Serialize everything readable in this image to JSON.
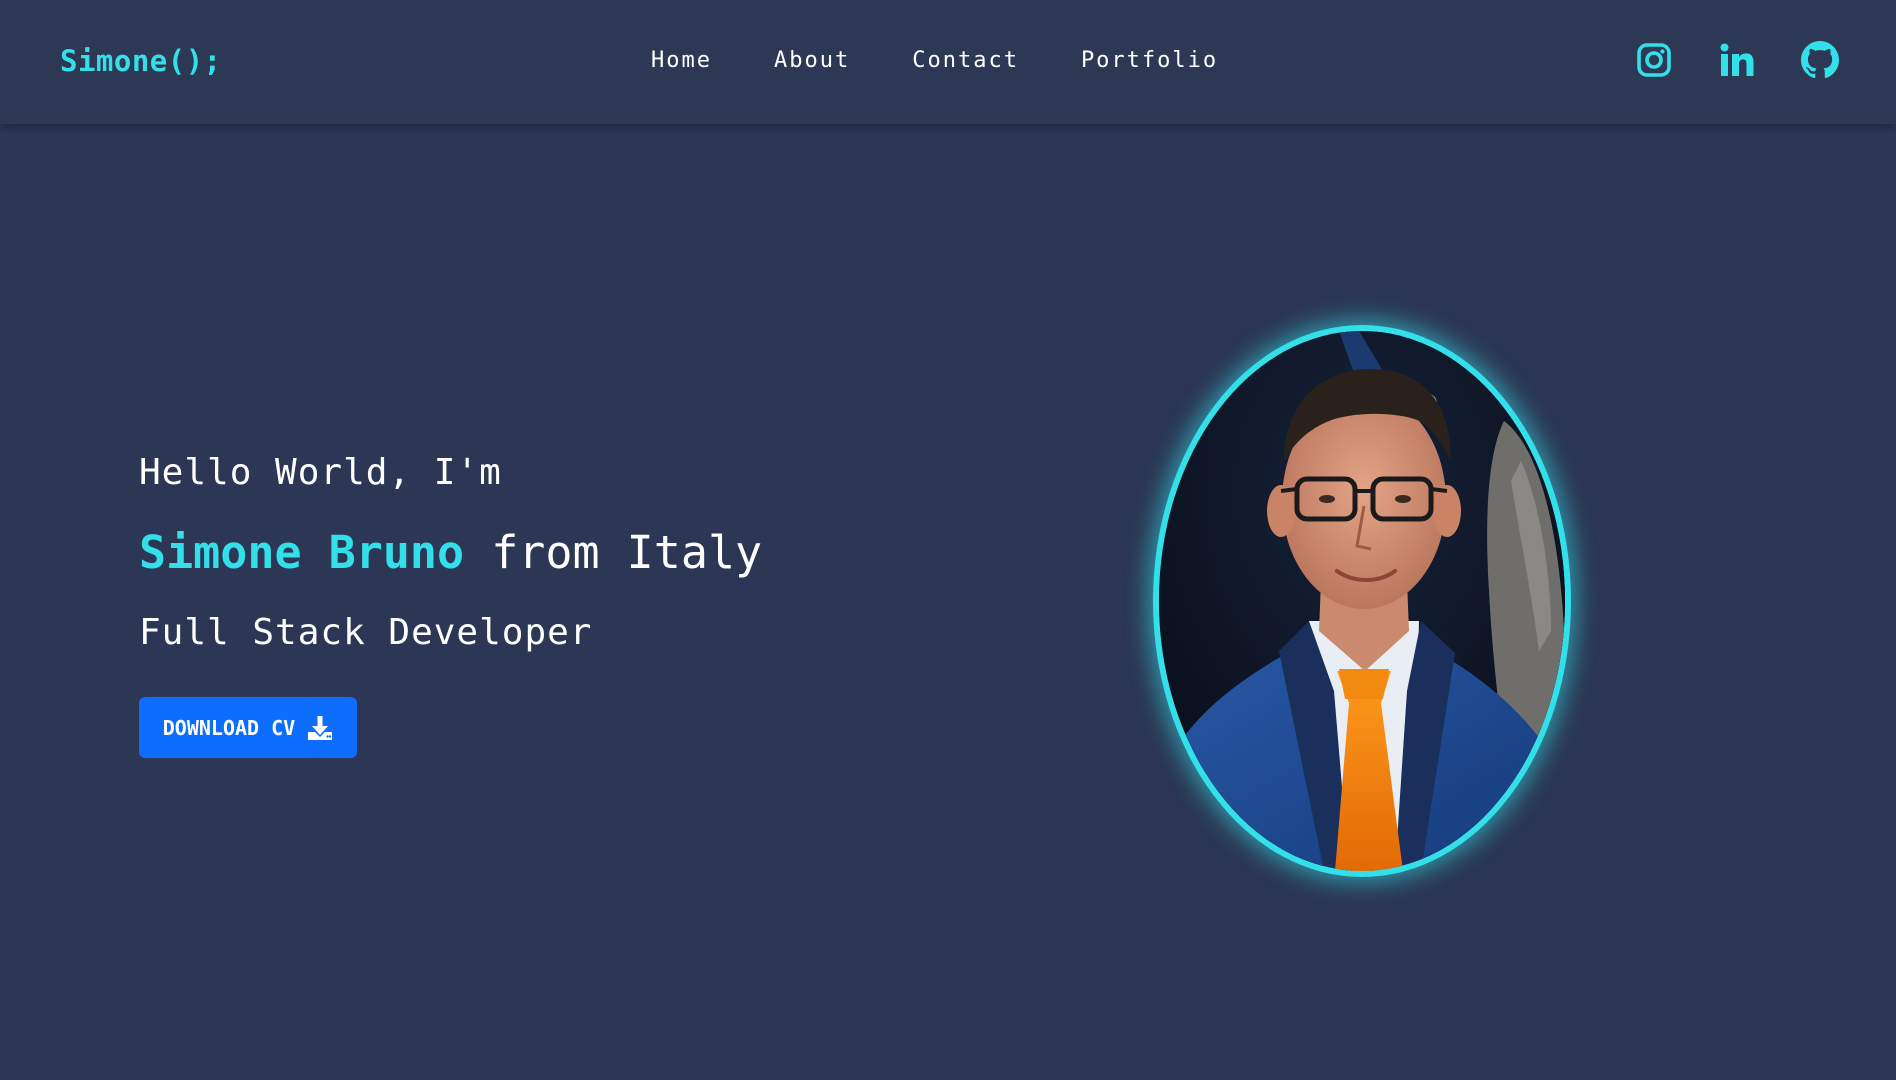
{
  "header": {
    "logo": "Simone();",
    "nav": [
      {
        "label": "Home"
      },
      {
        "label": "About"
      },
      {
        "label": "Contact"
      },
      {
        "label": "Portfolio"
      }
    ],
    "socials": [
      {
        "icon": "instagram-icon"
      },
      {
        "icon": "linkedin-icon"
      },
      {
        "icon": "github-icon"
      }
    ]
  },
  "hero": {
    "greeting": "Hello World, I'm",
    "name": "Simone Bruno",
    "origin": " from Italy",
    "role": "Full Stack Developer",
    "cta_label": "DOWNLOAD CV",
    "cta_icon": "download-icon"
  },
  "colors": {
    "background": "#2b3754",
    "accent": "#33e0ea",
    "button": "#0d6efd",
    "text": "#ffffff"
  }
}
